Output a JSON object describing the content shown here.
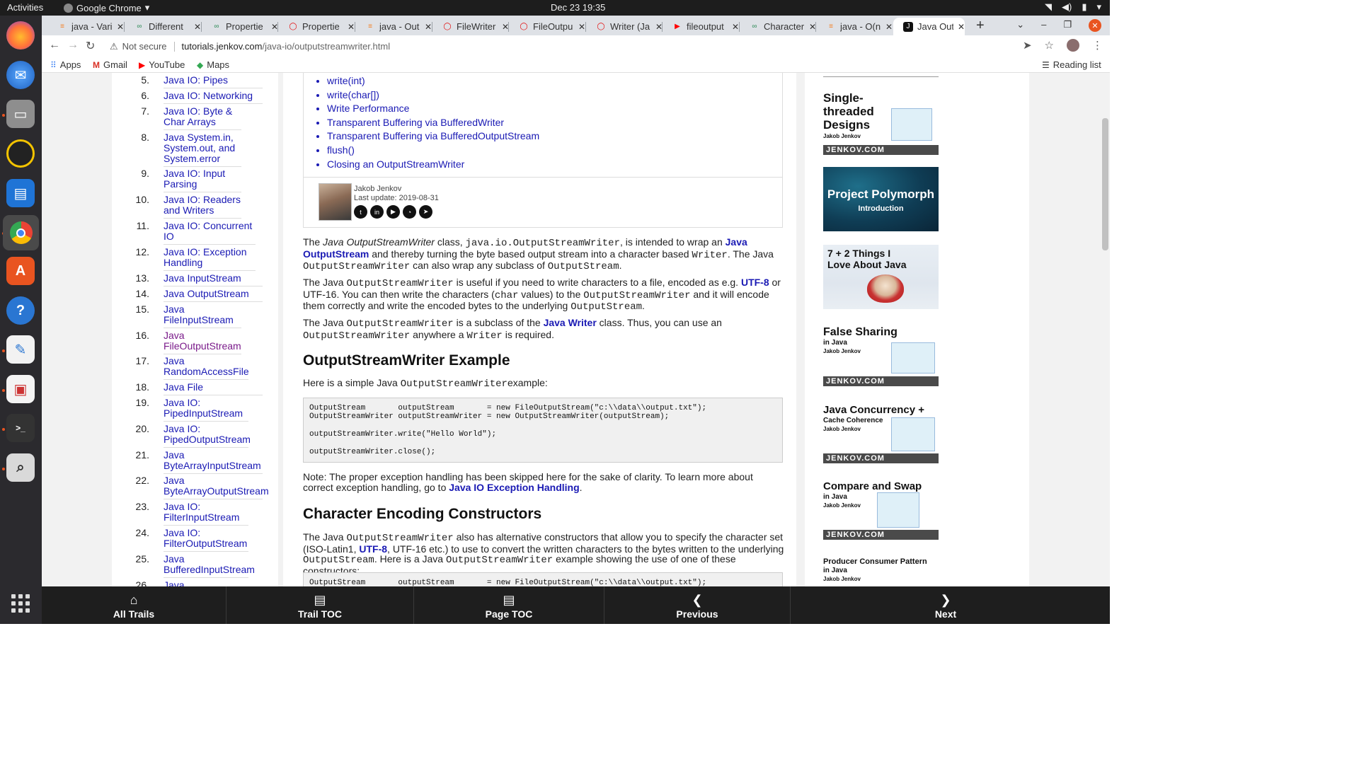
{
  "topbar": {
    "activities": "Activities",
    "app_name": "Google Chrome",
    "clock": "Dec 23  19:35"
  },
  "tabs": [
    {
      "title": "java - Vari",
      "icon": "stackoverflow-icon",
      "color": "#f48024"
    },
    {
      "title": "Different",
      "icon": "infinity-icon",
      "color": "#2e8b57"
    },
    {
      "title": "Propertie",
      "icon": "infinity-icon",
      "color": "#2e8b57"
    },
    {
      "title": "Propertie",
      "icon": "oracle-icon",
      "color": "#e30000"
    },
    {
      "title": "java - Out",
      "icon": "stackoverflow-icon",
      "color": "#f48024"
    },
    {
      "title": "FileWriter",
      "icon": "oracle-icon",
      "color": "#e30000"
    },
    {
      "title": "FileOutpu",
      "icon": "oracle-icon",
      "color": "#e30000"
    },
    {
      "title": "Writer (Ja",
      "icon": "oracle-icon",
      "color": "#e30000"
    },
    {
      "title": "fileoutput",
      "icon": "youtube-icon",
      "color": "#ff0000"
    },
    {
      "title": "Character",
      "icon": "infinity-icon",
      "color": "#2e8b57"
    },
    {
      "title": "java - O(n",
      "icon": "stackoverflow-icon",
      "color": "#f48024"
    },
    {
      "title": "Java Outp",
      "icon": "jenkov-icon",
      "color": "#111111",
      "active": true
    }
  ],
  "address": {
    "security": "Not secure",
    "host": "tutorials.jenkov.com",
    "path": "/java-io/outputstreamwriter.html"
  },
  "bookmarks": {
    "apps": "Apps",
    "gmail": "Gmail",
    "youtube": "YouTube",
    "maps": "Maps",
    "reading_list": "Reading list"
  },
  "left_toc": [
    {
      "num": "5.",
      "label": "Java IO: Pipes"
    },
    {
      "num": "6.",
      "label": "Java IO: Networking"
    },
    {
      "num": "7.",
      "label": "Java IO: Byte & Char Arrays"
    },
    {
      "num": "8.",
      "label": "Java System.in, System.out, and System.error"
    },
    {
      "num": "9.",
      "label": "Java IO: Input Parsing"
    },
    {
      "num": "10.",
      "label": "Java IO: Readers and Writers"
    },
    {
      "num": "11.",
      "label": "Java IO: Concurrent IO"
    },
    {
      "num": "12.",
      "label": "Java IO: Exception Handling"
    },
    {
      "num": "13.",
      "label": "Java InputStream"
    },
    {
      "num": "14.",
      "label": "Java OutputStream"
    },
    {
      "num": "15.",
      "label": "Java FileInputStream"
    },
    {
      "num": "16.",
      "label": "Java FileOutputStream"
    },
    {
      "num": "17.",
      "label": "Java RandomAccessFile"
    },
    {
      "num": "18.",
      "label": "Java File"
    },
    {
      "num": "19.",
      "label": "Java IO: PipedInputStream"
    },
    {
      "num": "20.",
      "label": "Java IO: PipedOutputStream"
    },
    {
      "num": "21.",
      "label": "Java ByteArrayInputStream"
    },
    {
      "num": "22.",
      "label": "Java ByteArrayOutputStream"
    },
    {
      "num": "23.",
      "label": "Java IO: FilterInputStream"
    },
    {
      "num": "24.",
      "label": "Java IO: FilterOutputStream"
    },
    {
      "num": "25.",
      "label": "Java BufferedInputStream"
    },
    {
      "num": "26.",
      "label": "Java"
    }
  ],
  "page_toc": [
    "write(int)",
    "write(char[])",
    "Write Performance",
    "Transparent Buffering via BufferedWriter",
    "Transparent Buffering via BufferedOutputStream",
    "flush()",
    "Closing an OutputStreamWriter"
  ],
  "author": {
    "name": "Jakob Jenkov",
    "updated": "Last update: 2019-08-31"
  },
  "content": {
    "h_example": "OutputStreamWriter Example",
    "example_intro_a": "Here is a simple Java ",
    "example_intro_code": "OutputStreamWriter",
    "example_intro_b": "example:",
    "code1": "OutputStream       outputStream       = new FileOutputStream(\"c:\\\\data\\\\output.txt\");\nOutputStreamWriter outputStreamWriter = new OutputStreamWriter(outputStream);\n\noutputStreamWriter.write(\"Hello World\");\n\noutputStreamWriter.close();",
    "note_text": "Note: The proper exception handling has been skipped here for the sake of clarity. To learn more about correct exception handling, go to ",
    "note_link": "Java IO Exception Handling",
    "h_encoding": "Character Encoding Constructors",
    "code2": "OutputStream       outputStream       = new FileOutputStream(\"c:\\\\data\\\\output.txt\");"
  },
  "ads": {
    "single_title": "Single-threaded Designs",
    "single_author": "Jakob Jenkov",
    "footer": "JENKOV.COM",
    "polymorph_title": "Project Polymorph",
    "polymorph_sub": "Introduction",
    "love_title": "7 + 2 Things I Love About Java",
    "fs_title": "False Sharing",
    "fs_sub": "in Java",
    "fs_author": "Jakob Jenkov",
    "jc_title": "Java Concurrency +",
    "jc_sub": "Cache Coherence",
    "jc_author": "Jakob Jenkov",
    "cas_title": "Compare and Swap",
    "cas_sub": "in Java",
    "cas_author": "Jakob Jenkov",
    "pc_title": "Producer Consumer Pattern",
    "pc_sub": "in Java",
    "pc_author": "Jakob Jenkov"
  },
  "trail_nav": {
    "all_trails": "All Trails",
    "trail_toc": "Trail TOC",
    "page_toc": "Page TOC",
    "previous": "Previous",
    "next": "Next"
  }
}
